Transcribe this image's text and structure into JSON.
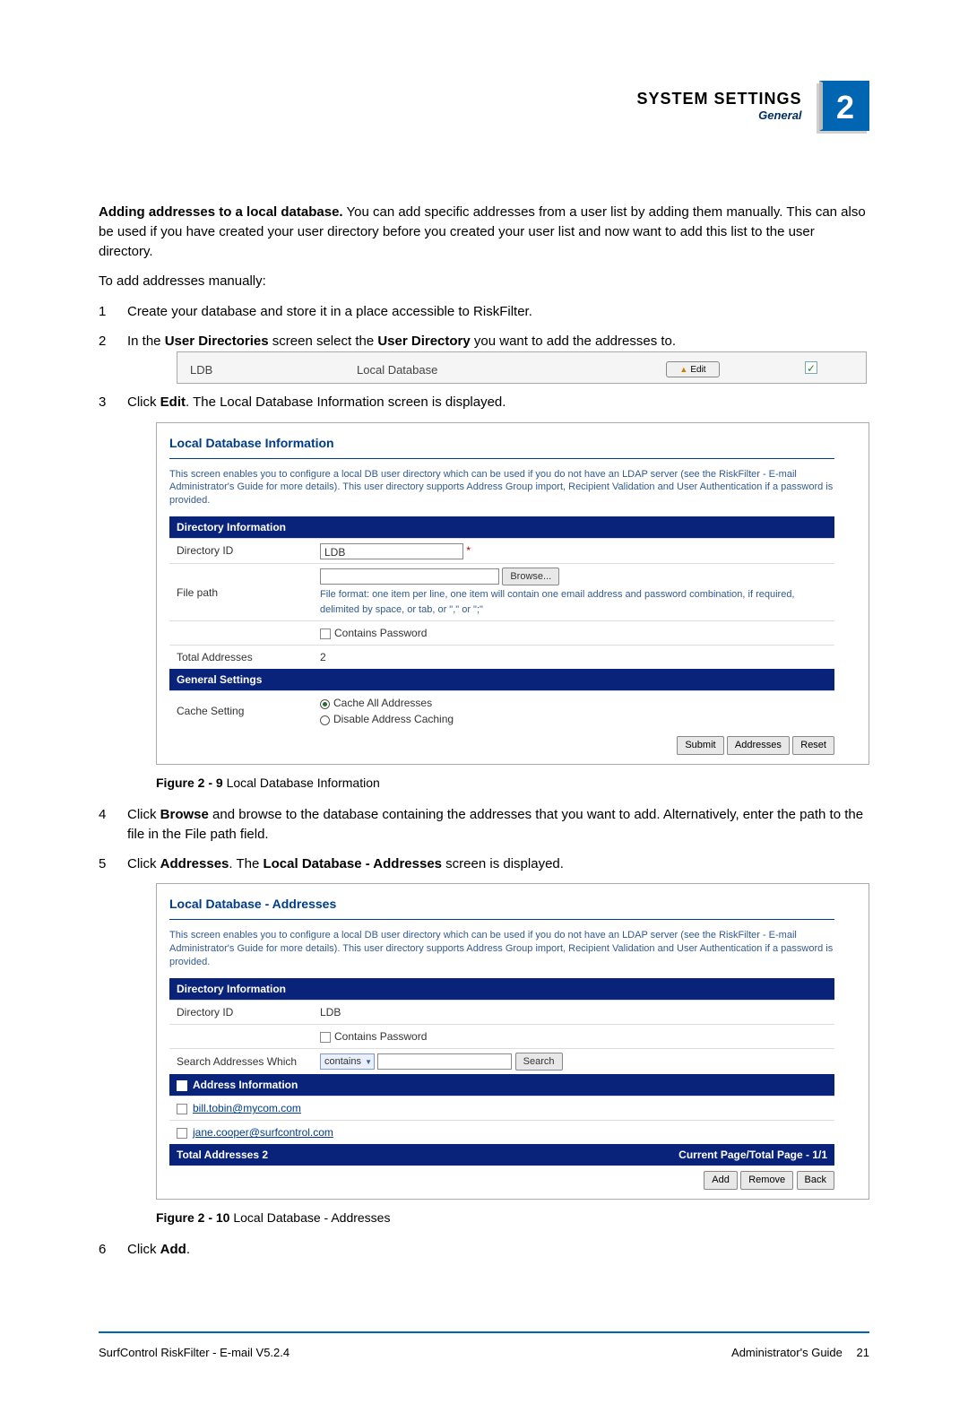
{
  "header": {
    "title": "SYSTEM SETTINGS",
    "subtitle": "General",
    "badge": "2"
  },
  "intro": {
    "heading": "Adding addresses to a local database.",
    "body": "You can add specific addresses from a user list by adding them manually. This can also be used if you have created your user directory before you created your user list and now want to add this list to the user directory.",
    "toadd": "To add addresses manually:"
  },
  "steps": {
    "s1": "Create your database and store it in a place accessible to RiskFilter.",
    "s2_a": "In the ",
    "s2_b": "User Directories",
    "s2_c": " screen select the ",
    "s2_d": "User Directory",
    "s2_e": " you want to add the addresses to.",
    "s3_a": "Click ",
    "s3_b": "Edit",
    "s3_c": ". The Local Database Information screen is displayed.",
    "s4_a": "Click ",
    "s4_b": "Browse",
    "s4_c": " and browse to the database containing the addresses that you want to add. Alternatively, enter the path to the file in the File path field.",
    "s5_a": "Click ",
    "s5_b": "Addresses",
    "s5_c": ". The ",
    "s5_d": "Local Database - Addresses",
    "s5_e": " screen is displayed.",
    "s6_a": "Click ",
    "s6_b": "Add",
    "s6_c": "."
  },
  "ss1": {
    "ldb": "LDB",
    "local": "Local Database",
    "edit": "Edit"
  },
  "panelA": {
    "title": "Local Database Information",
    "desc": "This screen enables you to configure a local DB user directory which can be used if you do not have an LDAP server (see the RiskFilter - E-mail Administrator's Guide for more details). This user directory supports Address Group import, Recipient Validation and User Authentication if a password is provided.",
    "sec_di": "Directory Information",
    "dir_id_lbl": "Directory ID",
    "dir_id_val": "LDB",
    "file_path_lbl": "File path",
    "browse": "Browse...",
    "file_hint": "File format: one item per line, one item will contain one email address and password combination, if required, delimited by space, or tab, or \",\" or \";\"",
    "contains_pw": "Contains Password",
    "total_addr_lbl": "Total Addresses",
    "total_addr_val": "2",
    "sec_gs": "General Settings",
    "cache_lbl": "Cache Setting",
    "cache_all": "Cache All Addresses",
    "disable_cache": "Disable Address Caching",
    "btn_submit": "Submit",
    "btn_addr": "Addresses",
    "btn_reset": "Reset"
  },
  "figA": {
    "label": "Figure 2 - 9",
    "text": " Local Database Information"
  },
  "panelB": {
    "title": "Local Database - Addresses",
    "desc": "This screen enables you to configure a local DB user directory which can be used if you do not have an LDAP server (see the RiskFilter - E-mail Administrator's Guide for more details). This user directory supports Address Group import, Recipient Validation and User Authentication if a password is provided.",
    "sec_di": "Directory Information",
    "dir_id_lbl": "Directory ID",
    "dir_id_val": "LDB",
    "contains_pw": "Contains Password",
    "search_lbl": "Search Addresses Which",
    "search_sel": "contains",
    "search_btn": "Search",
    "sec_ai": "Address Information",
    "addr1": "bill.tobin@mycom.com",
    "addr2": "jane.cooper@surfcontrol.com",
    "total_bar": "Total Addresses 2",
    "page_bar": "Current Page/Total Page - 1/1",
    "btn_add": "Add",
    "btn_remove": "Remove",
    "btn_back": "Back"
  },
  "figB": {
    "label": "Figure 2 - 10",
    "text": " Local Database - Addresses"
  },
  "footer": {
    "left": "SurfControl RiskFilter - E-mail V5.2.4",
    "right_a": "Administrator's Guide",
    "right_b": "21"
  }
}
